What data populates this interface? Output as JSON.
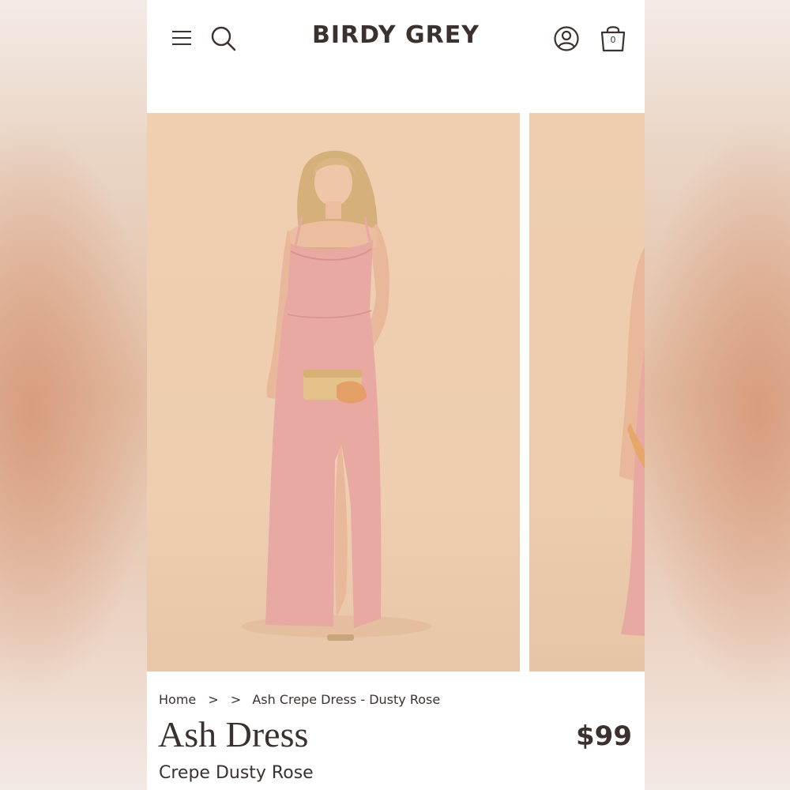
{
  "header": {
    "logo": "BIRDY GREY",
    "cart_count": "0",
    "icons": [
      "menu-icon",
      "search-icon",
      "account-icon",
      "shopping-bag-icon"
    ]
  },
  "breadcrumb": {
    "home": "Home",
    "sep1": ">",
    "sep2": ">",
    "current": "Ash Crepe Dress - Dusty Rose"
  },
  "product": {
    "title": "Ash Dress",
    "price": "$99",
    "subtitle": "Crepe Dusty Rose"
  },
  "colors": {
    "text": "#3b3230",
    "dress": "#e7a9a2",
    "backdrop": "#eecdb0"
  }
}
